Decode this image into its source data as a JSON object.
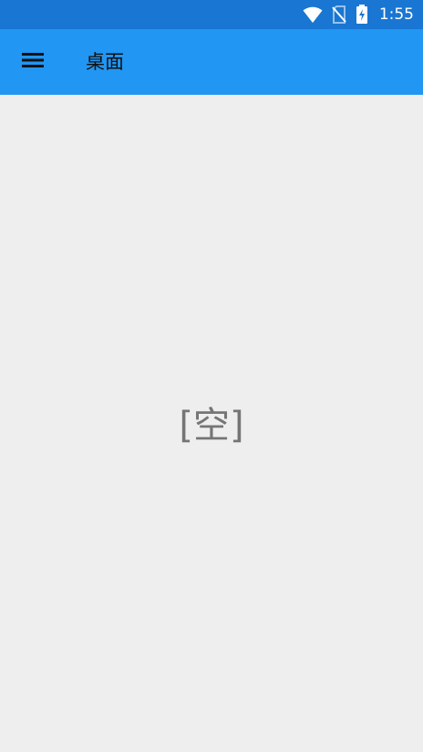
{
  "status_bar": {
    "time": "1:55",
    "background_color": "#1976d2",
    "icons": [
      "wifi-icon",
      "no-sim-icon",
      "battery-charging-icon"
    ]
  },
  "app_bar": {
    "title": "桌面",
    "background_color": "#2196f3",
    "menu_icon": "hamburger-menu-icon"
  },
  "main": {
    "empty_text": "[空]",
    "background_color": "#eeeeee"
  }
}
